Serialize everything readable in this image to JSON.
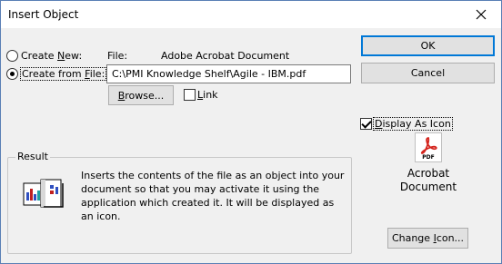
{
  "window": {
    "title": "Insert Object"
  },
  "source": {
    "create_new_pre": "Create ",
    "create_new_access": "N",
    "create_new_post": "ew:",
    "create_from_file_pre": "Create from ",
    "create_from_file_access": "F",
    "create_from_file_post": "ile:",
    "selected": "create_from_file"
  },
  "file": {
    "label": "File:",
    "type": "Adobe Acrobat Document",
    "path": "C:\\PMI Knowledge Shelf\\Agile - IBM.pdf",
    "browse_pre": "",
    "browse_access": "B",
    "browse_post": "rowse...",
    "link_pre": "",
    "link_access": "L",
    "link_post": "ink",
    "link_checked": false
  },
  "buttons": {
    "ok": "OK",
    "cancel": "Cancel",
    "change_icon_pre": "Change ",
    "change_icon_access": "I",
    "change_icon_post": "con..."
  },
  "display_as_icon": {
    "pre": "",
    "access": "D",
    "post": "isplay As Icon",
    "checked": true,
    "icon_caption_line1": "Acrobat",
    "icon_caption_line2": "Document",
    "icon_badge": "PDF"
  },
  "result": {
    "label": "Result",
    "text": "Inserts the contents of the file as an object into your document so that you may activate it using the application which created it.  It will be displayed as an icon."
  },
  "colors": {
    "pdf_red": "#d4231c",
    "focus_blue": "#0078d7"
  },
  "icons": {
    "close": "close-icon",
    "pdf": "pdf-icon",
    "result": "result-graphic-icon"
  }
}
